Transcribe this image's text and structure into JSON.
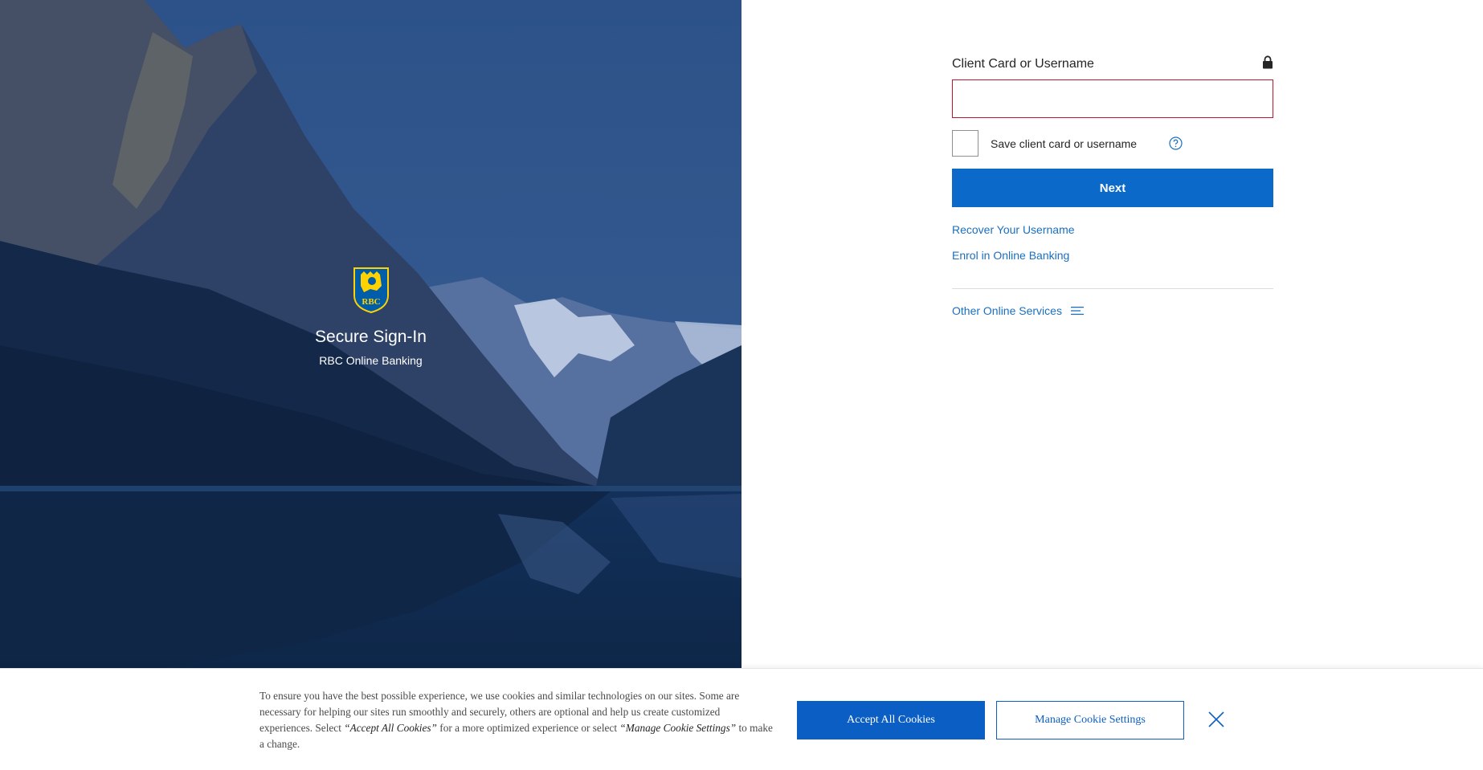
{
  "hero": {
    "logo_text": "RBC",
    "title": "Secure Sign-In",
    "subtitle": "RBC Online Banking"
  },
  "signin": {
    "field_label": "Client Card or Username",
    "field_value": "",
    "save_label": "Save client card or username",
    "save_checked": false,
    "next_label": "Next",
    "links": {
      "recover": "Recover Your Username",
      "enrol": "Enrol in Online Banking",
      "other_services": "Other Online Services"
    }
  },
  "icons": {
    "lock": "lock-icon",
    "help": "help-circle-icon",
    "menu": "menu-lines-icon",
    "close": "close-icon"
  },
  "cookie": {
    "text_1": "To ensure you have the best possible experience, we use cookies and similar technologies on our sites. Some are necessary for helping our sites run smoothly and securely, others are optional and help us create customized experiences. Select ",
    "accept_quote": "“Accept All Cookies”",
    "text_2": " for a more optimized experience or select ",
    "manage_quote": "“Manage Cookie Settings”",
    "text_3": " to make a change.",
    "accept_label": "Accept All Cookies",
    "manage_label": "Manage Cookie Settings"
  },
  "colors": {
    "primary": "#0b6ac9",
    "link": "#1a6fbf",
    "error_border": "#c3142d",
    "hero_dark": "#0f2a50",
    "logo_blue": "#005daa",
    "logo_gold": "#ffd200"
  }
}
